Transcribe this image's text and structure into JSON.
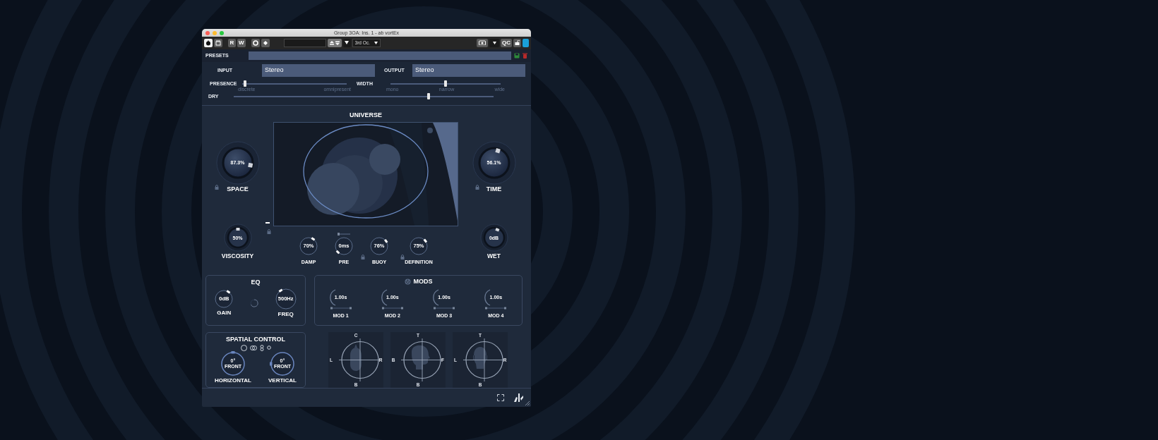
{
  "window": {
    "title": "Group 3OA: Ins. 1 - ab vortEx"
  },
  "toolbar": {
    "record_buttons": [
      "R",
      "W"
    ],
    "band_dropdown": "3rd Oc.",
    "qc_button": "QC"
  },
  "presets": {
    "label": "PRESETS"
  },
  "io": [
    {
      "label": "INPUT",
      "value": "Stereo"
    },
    {
      "label": "OUTPUT",
      "value": "Stereo"
    }
  ],
  "sliders": [
    {
      "label": "PRESENCE",
      "level": 0.03,
      "marks": [
        "discrete",
        "omnipresent"
      ]
    },
    {
      "label": "WIDTH",
      "level": 0.5,
      "marks": [
        "mono",
        "narrow",
        "wide"
      ]
    }
  ],
  "dry": {
    "label": "DRY",
    "level": 0.75
  },
  "universe": {
    "title": "UNIVERSE"
  },
  "main_knobs": [
    {
      "label": "SPACE",
      "value": "87.3%",
      "locked": true
    },
    {
      "label": "TIME",
      "value": "56.1%",
      "locked": true
    }
  ],
  "side_knobs": [
    {
      "label": "VISCOSITY",
      "value": "50%"
    },
    {
      "label": "WET",
      "value": "0dB"
    }
  ],
  "small_knobs": [
    {
      "label": "DAMP",
      "value": "70%",
      "locked": true
    },
    {
      "label": "PRE",
      "value": "0ms",
      "locked": false
    },
    {
      "label": "BUOY",
      "value": "76%",
      "locked": true
    },
    {
      "label": "DEFINITION",
      "value": "75%",
      "locked": true
    }
  ],
  "pre_slider": {
    "level": 0.0
  },
  "eq": {
    "title": "EQ",
    "knobs": [
      {
        "label": "GAIN",
        "value": "0dB"
      },
      {
        "label": "FREQ",
        "value": "500Hz"
      }
    ]
  },
  "mods": {
    "title": "MODS",
    "items": [
      {
        "label": "MOD 1",
        "value": "1.00s",
        "level": 1.0
      },
      {
        "label": "MOD 2",
        "value": "1.00s",
        "level": 1.0
      },
      {
        "label": "MOD 3",
        "value": "1.00s",
        "level": 1.0
      },
      {
        "label": "MOD 4",
        "value": "1.00s",
        "level": 1.0
      }
    ]
  },
  "spatial": {
    "title": "SPATIAL CONTROL",
    "knobs": [
      {
        "label": "HORIZONTAL",
        "value": "0°",
        "sub": "FRONT"
      },
      {
        "label": "VERTICAL",
        "value": "0°",
        "sub": "FRONT"
      }
    ]
  },
  "heads": [
    {
      "kind": "top",
      "axes": [
        "C",
        "L",
        "R",
        "B"
      ]
    },
    {
      "kind": "side",
      "axes": [
        "T",
        "B",
        "F",
        "B"
      ]
    },
    {
      "kind": "front",
      "axes": [
        "T",
        "L",
        "R",
        "B"
      ]
    }
  ]
}
